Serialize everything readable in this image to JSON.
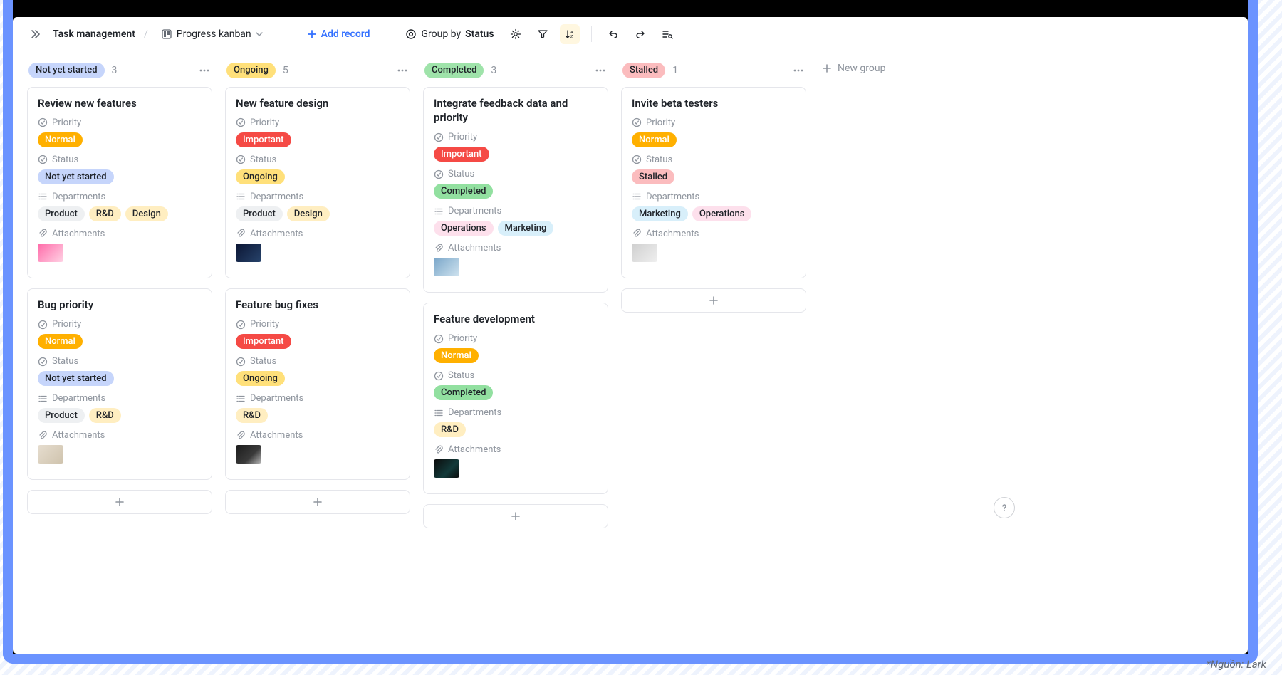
{
  "toolbar": {
    "breadcrumb_title": "Task management",
    "view_name": "Progress kanban",
    "add_record": "Add record",
    "group_prefix": "Group by ",
    "group_field": "Status",
    "new_group": "New group"
  },
  "columns": [
    {
      "label": "Not yet started",
      "count": "3",
      "chip_color": "blue",
      "cards": [
        {
          "title": "Review new features",
          "priority": {
            "label": "Priority",
            "value": "Normal",
            "color": "orange"
          },
          "status": {
            "label": "Status",
            "value": "Not yet started",
            "color": "blue"
          },
          "departments": {
            "label": "Departments",
            "values": [
              {
                "t": "Product",
                "c": "gray"
              },
              {
                "t": "R&D",
                "c": "lightyellow"
              },
              {
                "t": "Design",
                "c": "lightyellow"
              }
            ]
          },
          "attachments": {
            "label": "Attachments",
            "thumb": "linear-gradient(135deg,#ff6aa8,#ffd3e5)"
          }
        },
        {
          "title": "Bug priority",
          "priority": {
            "label": "Priority",
            "value": "Normal",
            "color": "orange"
          },
          "status": {
            "label": "Status",
            "value": "Not yet started",
            "color": "blue"
          },
          "departments": {
            "label": "Departments",
            "values": [
              {
                "t": "Product",
                "c": "gray"
              },
              {
                "t": "R&D",
                "c": "lightyellow"
              }
            ]
          },
          "attachments": {
            "label": "Attachments",
            "thumb": "linear-gradient(135deg,#e6ddcf,#cfc3ad)"
          }
        }
      ]
    },
    {
      "label": "Ongoing",
      "count": "5",
      "chip_color": "yellow",
      "cards": [
        {
          "title": "New feature design",
          "priority": {
            "label": "Priority",
            "value": "Important",
            "color": "red"
          },
          "status": {
            "label": "Status",
            "value": "Ongoing",
            "color": "yellow"
          },
          "departments": {
            "label": "Departments",
            "values": [
              {
                "t": "Product",
                "c": "gray"
              },
              {
                "t": "Design",
                "c": "lightyellow"
              }
            ]
          },
          "attachments": {
            "label": "Attachments",
            "thumb": "linear-gradient(135deg,#0b1533,#27436b)"
          }
        },
        {
          "title": "Feature bug fixes",
          "priority": {
            "label": "Priority",
            "value": "Important",
            "color": "red"
          },
          "status": {
            "label": "Status",
            "value": "Ongoing",
            "color": "yellow"
          },
          "departments": {
            "label": "Departments",
            "values": [
              {
                "t": "R&D",
                "c": "lightyellow"
              }
            ]
          },
          "attachments": {
            "label": "Attachments",
            "thumb": "linear-gradient(135deg,#1b1b1b,#3a3a3a 60%,#b7b7b7)"
          }
        }
      ]
    },
    {
      "label": "Completed",
      "count": "3",
      "chip_color": "green",
      "cards": [
        {
          "title": "Integrate feedback data and priority",
          "priority": {
            "label": "Priority",
            "value": "Important",
            "color": "red"
          },
          "status": {
            "label": "Status",
            "value": "Completed",
            "color": "green"
          },
          "departments": {
            "label": "Departments",
            "values": [
              {
                "t": "Operations",
                "c": "pink"
              },
              {
                "t": "Marketing",
                "c": "teal"
              }
            ]
          },
          "attachments": {
            "label": "Attachments",
            "thumb": "linear-gradient(135deg,#7aa6c9,#cfe3ef)"
          }
        },
        {
          "title": "Feature development",
          "priority": {
            "label": "Priority",
            "value": "Normal",
            "color": "orange"
          },
          "status": {
            "label": "Status",
            "value": "Completed",
            "color": "green"
          },
          "departments": {
            "label": "Departments",
            "values": [
              {
                "t": "R&D",
                "c": "lightyellow"
              }
            ]
          },
          "attachments": {
            "label": "Attachments",
            "thumb": "linear-gradient(135deg,#0b0b0b,#123a3a 60%,#0b0b0b)"
          }
        }
      ]
    },
    {
      "label": "Stalled",
      "count": "1",
      "chip_color": "stalled",
      "cards": [
        {
          "title": "Invite beta testers",
          "priority": {
            "label": "Priority",
            "value": "Normal",
            "color": "orange"
          },
          "status": {
            "label": "Status",
            "value": "Stalled",
            "color": "stalled"
          },
          "departments": {
            "label": "Departments",
            "values": [
              {
                "t": "Marketing",
                "c": "teal"
              },
              {
                "t": "Operations",
                "c": "pink"
              }
            ]
          },
          "attachments": {
            "label": "Attachments",
            "thumb": "linear-gradient(135deg,#cfcfcf,#efefef)"
          }
        }
      ]
    }
  ],
  "footnote": "*Nguồn: Lark"
}
